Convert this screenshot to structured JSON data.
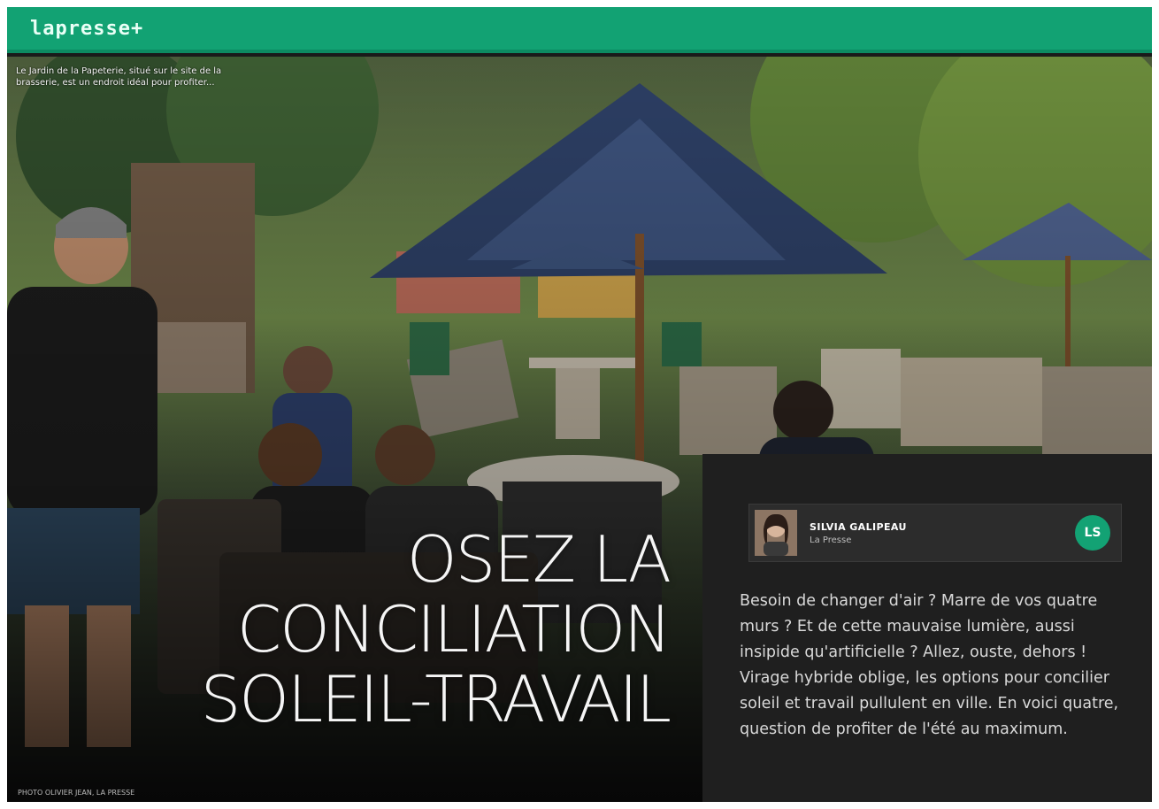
{
  "header": {
    "logo": "lapresse+",
    "brand_color": "#12a273"
  },
  "hero": {
    "caption": "Le Jardin de la Papeterie, situé sur le site de la brasserie, est un endroit idéal pour profiter...",
    "headline_lines": [
      "OSEZ LA",
      "CONCILIATION",
      "SOLEIL-TRAVAIL"
    ],
    "photo_credit": "PHOTO OLIVIER JEAN, LA PRESSE"
  },
  "author_card": {
    "name": "SILVIA GALIPEAU",
    "publication": "La Presse",
    "badge": "LS",
    "avatar_icon": "author-photo"
  },
  "lead": "Besoin de changer d'air ? Marre de vos quatre murs ? Et de cette mauvaise lumière, aussi insipide qu'artificielle ? Allez, ouste, dehors ! Virage hybride oblige, les options pour concilier soleil et travail pullulent en ville. En voici quatre, question de profiter de l'été au maximum."
}
